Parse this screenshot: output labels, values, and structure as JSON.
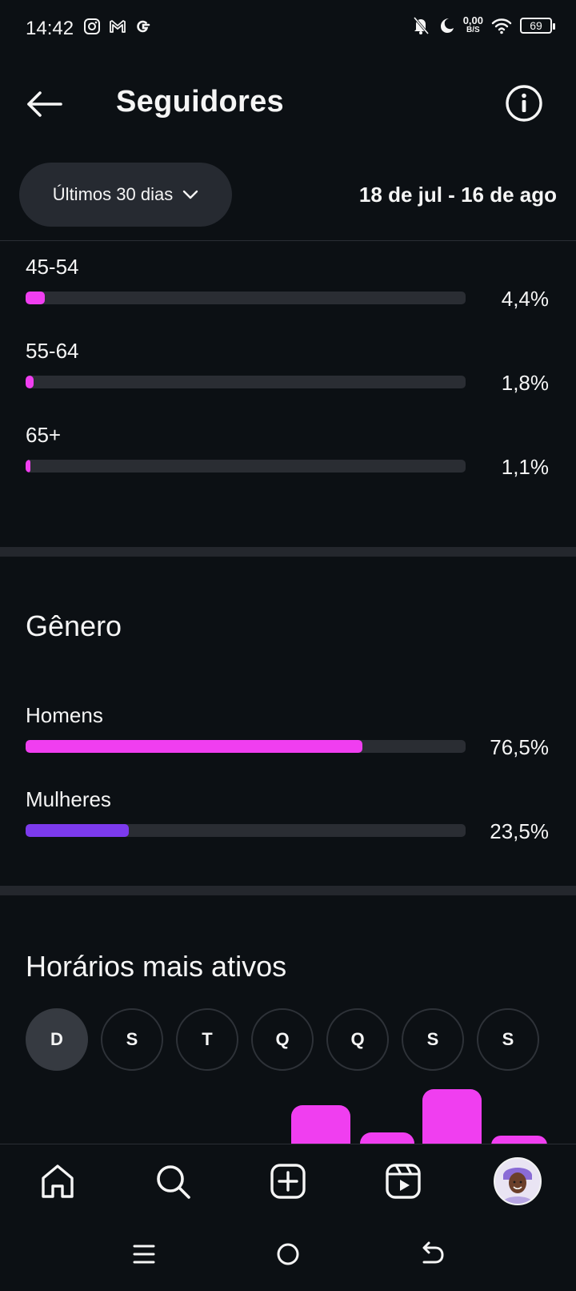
{
  "status_bar": {
    "time": "14:42",
    "net_speed": "0,00",
    "net_unit": "B/S",
    "battery": "69"
  },
  "header": {
    "title": "Seguidores"
  },
  "filter": {
    "period_label": "Últimos 30 dias",
    "date_range": "18 de jul - 16 de ago"
  },
  "age_section": {
    "rows": [
      {
        "label": "45-54",
        "value": "4,4%",
        "fraction": 0.044,
        "color": "#f03ef0"
      },
      {
        "label": "55-64",
        "value": "1,8%",
        "fraction": 0.018,
        "color": "#f03ef0"
      },
      {
        "label": "65+",
        "value": "1,1%",
        "fraction": 0.011,
        "color": "#f03ef0"
      }
    ]
  },
  "gender_section": {
    "title": "Gênero",
    "rows": [
      {
        "label": "Homens",
        "value": "76,5%",
        "fraction": 0.765,
        "color": "#f03ef0"
      },
      {
        "label": "Mulheres",
        "value": "23,5%",
        "fraction": 0.235,
        "color": "#7c3aed"
      }
    ]
  },
  "active_hours": {
    "title": "Horários mais ativos",
    "days": [
      "D",
      "S",
      "T",
      "Q",
      "Q",
      "S",
      "S"
    ],
    "selected_day_index": 0
  },
  "colors": {
    "accent_pink": "#f03ef0",
    "accent_purple": "#7c3aed",
    "background": "#0c1014"
  }
}
